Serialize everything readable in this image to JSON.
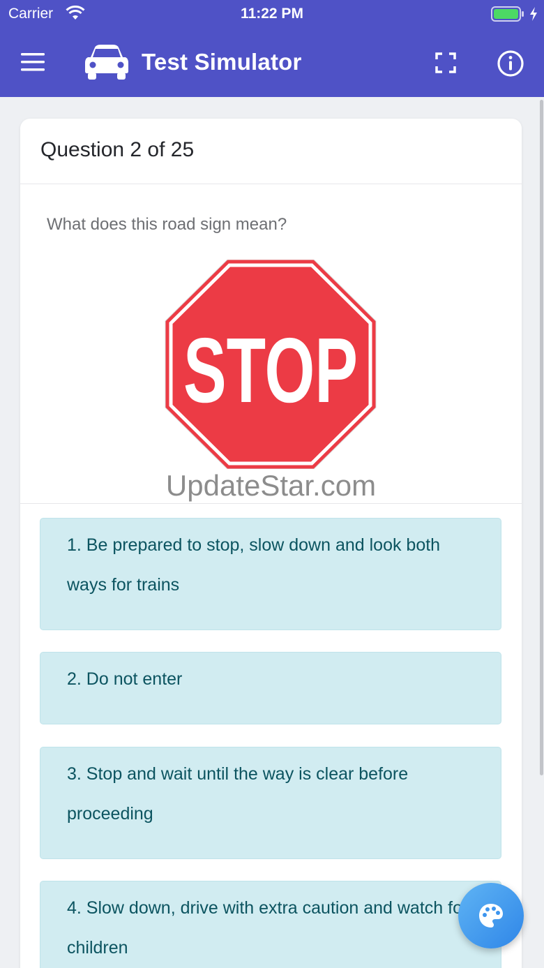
{
  "status_bar": {
    "carrier": "Carrier",
    "time": "11:22 PM",
    "battery_level": 1.0
  },
  "app_bar": {
    "title": "Test Simulator",
    "icons": [
      "menu-icon",
      "car-icon",
      "fullscreen-icon",
      "info-icon"
    ]
  },
  "question": {
    "counter": "Question 2 of 25",
    "prompt": "What does this road sign mean?",
    "sign_text": "STOP",
    "watermark": "UpdateStar.com",
    "answers": [
      {
        "label": "1. Be prepared to stop, slow down and look both ways for trains"
      },
      {
        "label": "2. Do not enter"
      },
      {
        "label": "3. Stop and wait until the way is clear before proceeding"
      },
      {
        "label": "4. Slow down, drive with extra caution and watch for children"
      }
    ]
  },
  "fab": {
    "icon": "palette-icon"
  },
  "colors": {
    "app_bar": "#4f52c6",
    "answer_bg": "#d1ecf1",
    "answer_text": "#0c5460",
    "stop_red": "#ec3b45",
    "fab_blue": "#2f86e8"
  }
}
